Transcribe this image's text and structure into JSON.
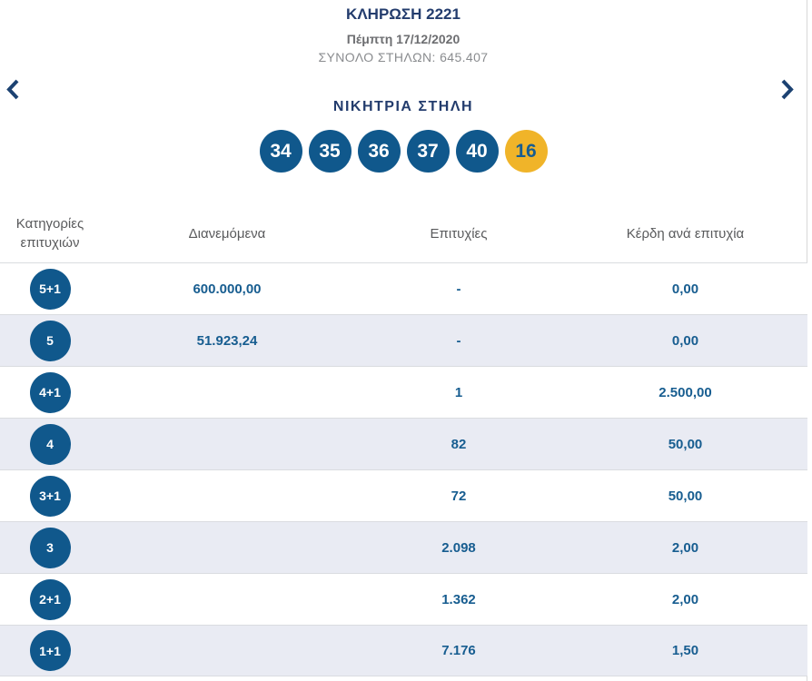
{
  "header": {
    "title": "ΚΛΗΡΩΣΗ 2221",
    "date": "Πέμπτη 17/12/2020",
    "total_columns": "ΣΥΝΟΛΟ ΣΤΗΛΩΝ: 645.407"
  },
  "winning": {
    "heading": "ΝΙΚΗΤΡΙΑ ΣΤΗΛΗ",
    "balls": [
      {
        "value": "34",
        "type": "main"
      },
      {
        "value": "35",
        "type": "main"
      },
      {
        "value": "36",
        "type": "main"
      },
      {
        "value": "37",
        "type": "main"
      },
      {
        "value": "40",
        "type": "main"
      },
      {
        "value": "16",
        "type": "bonus"
      }
    ]
  },
  "table": {
    "headers": {
      "category": "Κατηγορίες επιτυχιών",
      "distributed": "Διανεμόμενα",
      "hits": "Επιτυχίες",
      "prize": "Κέρδη ανά επιτυχία"
    },
    "rows": [
      {
        "category": "5+1",
        "distributed": "600.000,00",
        "hits": "-",
        "prize": "0,00"
      },
      {
        "category": "5",
        "distributed": "51.923,24",
        "hits": "-",
        "prize": "0,00"
      },
      {
        "category": "4+1",
        "distributed": "",
        "hits": "1",
        "prize": "2.500,00"
      },
      {
        "category": "4",
        "distributed": "",
        "hits": "82",
        "prize": "50,00"
      },
      {
        "category": "3+1",
        "distributed": "",
        "hits": "72",
        "prize": "50,00"
      },
      {
        "category": "3",
        "distributed": "",
        "hits": "2.098",
        "prize": "2,00"
      },
      {
        "category": "2+1",
        "distributed": "",
        "hits": "1.362",
        "prize": "2,00"
      },
      {
        "category": "1+1",
        "distributed": "",
        "hits": "7.176",
        "prize": "1,50"
      }
    ]
  },
  "colors": {
    "ball_blue": "#10588C",
    "bonus_yellow": "#F0B429",
    "heading_navy": "#233C6D",
    "value_blue": "#175D90",
    "row_stripe": "#E9EBF3"
  }
}
